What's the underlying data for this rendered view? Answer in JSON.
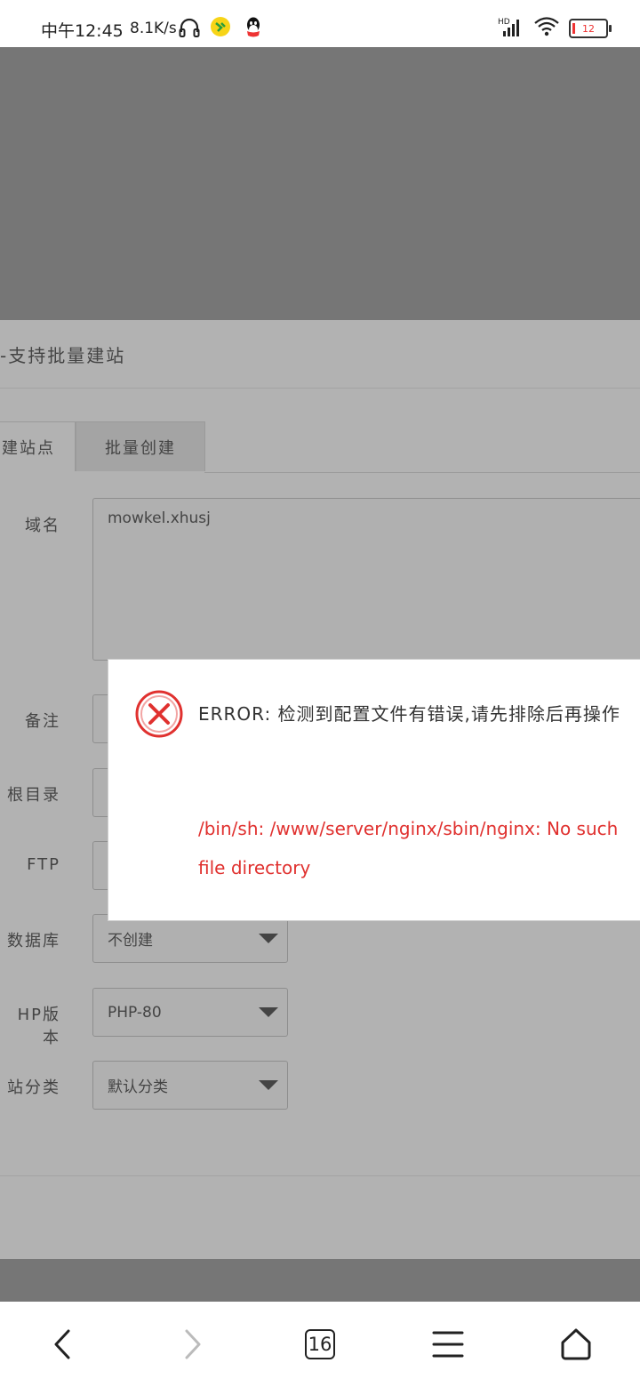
{
  "status_bar": {
    "time": "中午12:45",
    "speed": "8.1K/s",
    "battery": "12"
  },
  "panel": {
    "title": "-支持批量建站",
    "tabs": [
      "建站点",
      "批量创建"
    ]
  },
  "form": {
    "domain_label": "域名",
    "domain_value": "mowkel.xhusj",
    "remark_label": "备注",
    "root_label": "根目录",
    "ftp_label": "FTP",
    "db_label": "数据库",
    "db_value": "不创建",
    "php_label": "HP版本",
    "php_value": "PHP-80",
    "category_label": "站分类",
    "category_value": "默认分类"
  },
  "dialog": {
    "message": "ERROR: 检测到配置文件有错误,请先排除后再操作",
    "detail": "/bin/sh: /www/server/nginx/sbin/nginx: No such file directory"
  },
  "navbar": {
    "tabs_count": "16"
  },
  "colors": {
    "error_red": "#e0312f",
    "overlay": "#767676"
  },
  "icons": [
    "headset-icon",
    "app-icon",
    "qq-icon",
    "signal-icon",
    "wifi-icon",
    "battery-icon",
    "error-circle-icon",
    "back-icon",
    "forward-icon",
    "tabs-icon",
    "menu-icon",
    "home-icon"
  ]
}
